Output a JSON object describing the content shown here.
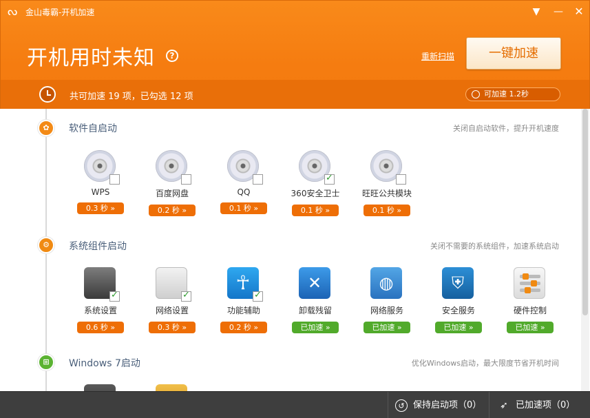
{
  "window": {
    "title": "金山毒霸-开机加速"
  },
  "header": {
    "boot_time_title": "开机用时未知",
    "help_icon": "?",
    "rescan_label": "重新扫描",
    "accelerate_button": "一键加速",
    "summary": "共可加速 19 项，已勾选 12 项",
    "speed_pill": "可加速 1.2秒"
  },
  "sections": [
    {
      "title": "软件自启动",
      "hint": "关闭自启动软件，提升开机速度",
      "items": [
        {
          "label": "WPS",
          "tag": "0.3 秒 »",
          "checked": false,
          "icon": "cd-icon"
        },
        {
          "label": "百度网盘",
          "tag": "0.2 秒 »",
          "checked": false,
          "icon": "cd-icon"
        },
        {
          "label": "QQ",
          "tag": "0.1 秒 »",
          "checked": false,
          "icon": "cd-icon"
        },
        {
          "label": "360安全卫士",
          "tag": "0.1 秒 »",
          "checked": true,
          "icon": "cd-icon"
        },
        {
          "label": "旺旺公共模块",
          "tag": "0.1 秒 »",
          "checked": false,
          "icon": "cd-icon"
        }
      ]
    },
    {
      "title": "系统组件启动",
      "hint": "关闭不需要的系统组件，加速系统启动",
      "items": [
        {
          "label": "系统设置",
          "tag": "0.6 秒 »",
          "checked": true,
          "icon": "gauge-icon"
        },
        {
          "label": "网络设置",
          "tag": "0.3 秒 »",
          "checked": true,
          "icon": "network-chart-icon"
        },
        {
          "label": "功能辅助",
          "tag": "0.2 秒 »",
          "checked": true,
          "icon": "accessibility-icon"
        },
        {
          "label": "卸载残留",
          "tag": "已加速 »",
          "checked": null,
          "icon": "tools-icon"
        },
        {
          "label": "网络服务",
          "tag": "已加速 »",
          "checked": null,
          "icon": "globe-icon"
        },
        {
          "label": "安全服务",
          "tag": "已加速 »",
          "checked": null,
          "icon": "shield-icon"
        },
        {
          "label": "硬件控制",
          "tag": "已加速 »",
          "checked": null,
          "icon": "sliders-icon"
        }
      ]
    },
    {
      "title": "Windows 7启动",
      "hint": "优化Windows启动，最大限度节省开机时间"
    }
  ],
  "footer": {
    "keep_label": "保持启动项（0）",
    "done_label": "已加速项（0）"
  },
  "colors": {
    "brand_orange": "#f57c10",
    "tag_orange": "#ee6e06",
    "tag_green": "#51aa2b",
    "footer": "#3e3e3e"
  }
}
